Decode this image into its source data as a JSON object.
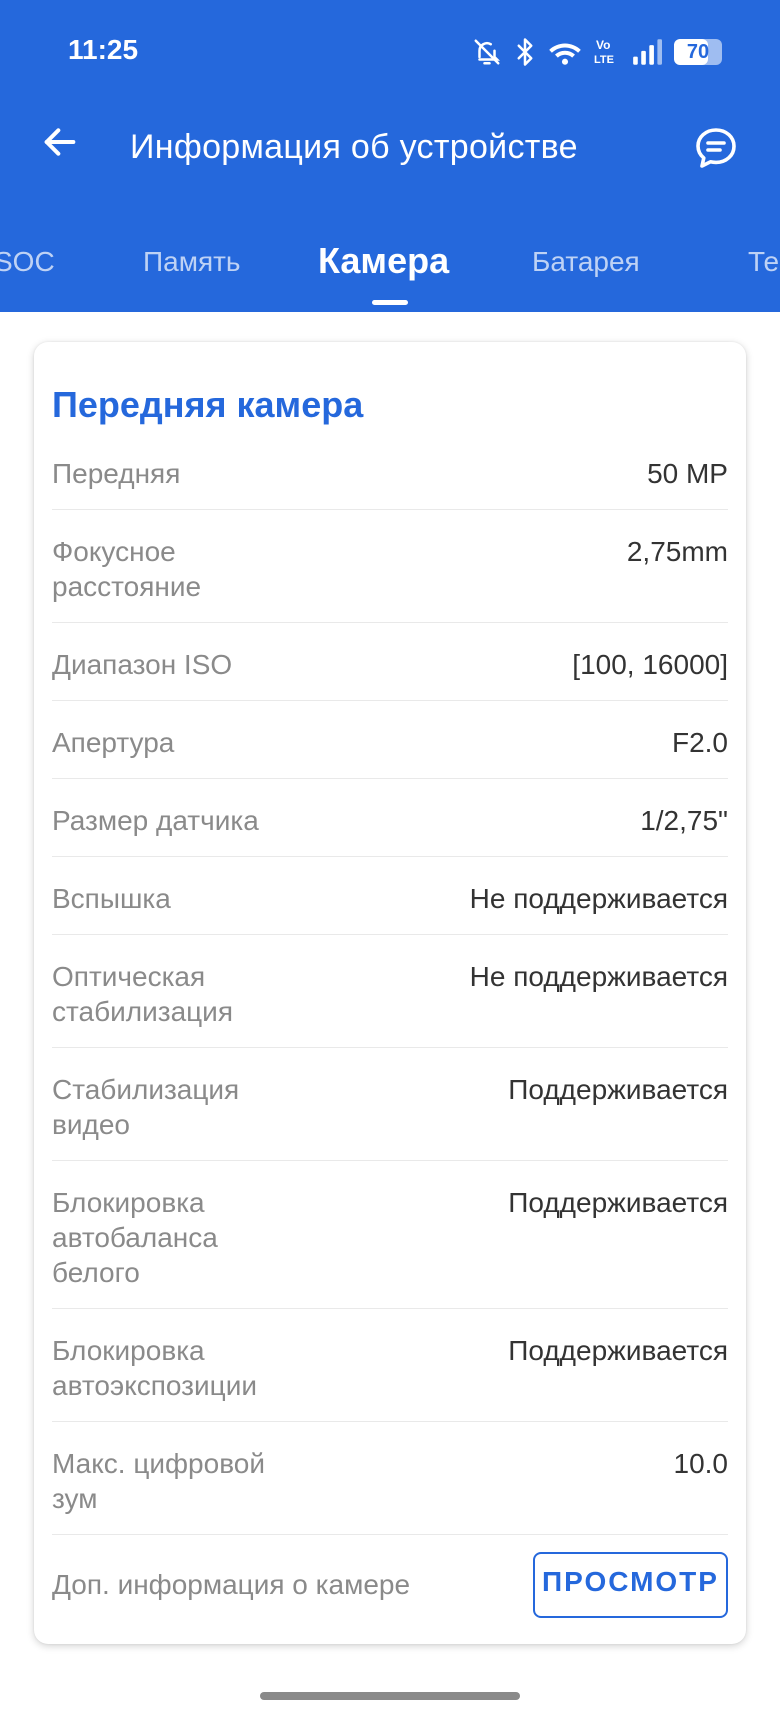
{
  "status_bar": {
    "time": "11:25",
    "battery_level": "70",
    "volte": "Vo LTE",
    "icons": [
      "bell-off-icon",
      "bluetooth-icon",
      "wifi-icon",
      "volte-icon",
      "signal-icon",
      "battery-icon"
    ]
  },
  "app_bar": {
    "title": "Информация об устройстве",
    "back_icon": "arrow-left-icon",
    "feedback_icon": "chat-bubble-icon"
  },
  "tabs": [
    {
      "label": "SOC",
      "active": false
    },
    {
      "label": "Память",
      "active": false
    },
    {
      "label": "Камера",
      "active": true
    },
    {
      "label": "Батарея",
      "active": false
    },
    {
      "label": "Те",
      "active": false
    }
  ],
  "camera_card": {
    "title": "Передняя камера",
    "rows": [
      {
        "label": "Передняя",
        "value": "50 MP"
      },
      {
        "label": "Фокусное расстояние",
        "value": "2,75mm"
      },
      {
        "label": "Диапазон ISO",
        "value": "[100, 16000]"
      },
      {
        "label": "Апертура",
        "value": "F2.0"
      },
      {
        "label": "Размер датчика",
        "value": "1/2,75\""
      },
      {
        "label": "Вспышка",
        "value": "Не поддерживается"
      },
      {
        "label": "Оптическая стабилизация",
        "value": "Не поддерживается"
      },
      {
        "label": "Стабилизация видео",
        "value": "Поддерживается"
      },
      {
        "label": "Блокировка автобаланса белого",
        "value": "Поддерживается"
      },
      {
        "label": "Блокировка автоэкспозиции",
        "value": "Поддерживается"
      },
      {
        "label": "Макс. цифровой зум",
        "value": "10.0"
      }
    ],
    "extra_label": "Доп. информация о камере",
    "view_button_label": "ПРОСМОТР"
  },
  "colors": {
    "primary": "#2568dc",
    "label": "#8a8a8a",
    "value": "#333333"
  }
}
